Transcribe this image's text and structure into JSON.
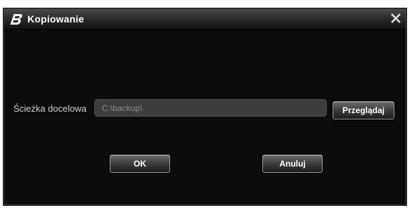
{
  "window": {
    "title": "Kopiowanie",
    "icon": "app-logo-icon",
    "close_icon": "close-icon"
  },
  "form": {
    "path_label": "Ścieżka docelowa",
    "path_value": "C:\\backup\\"
  },
  "buttons": {
    "browse_label": "Przeglądaj",
    "ok_label": "OK",
    "cancel_label": "Anuluj"
  },
  "colors": {
    "background": "#0c0c0c",
    "titlebar_top": "#4a4a4a",
    "input_bg": "#3d3d3d",
    "text": "#ffffff"
  }
}
